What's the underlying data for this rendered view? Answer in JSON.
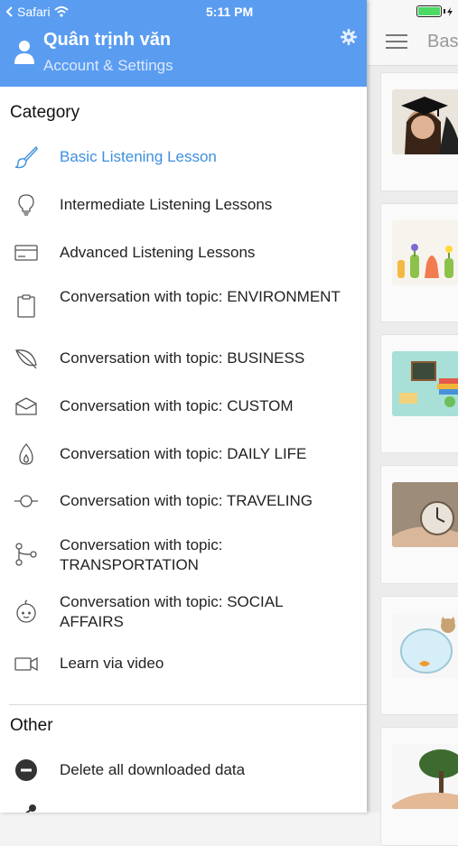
{
  "status": {
    "carrier": "Safari",
    "time": "5:11 PM"
  },
  "content": {
    "title": "Bas"
  },
  "drawer": {
    "user_name": "Quân trịnh văn",
    "subtitle": "Account & Settings",
    "category_title": "Category",
    "items": [
      {
        "label": "Basic Listening Lesson",
        "icon": "paintbrush-icon",
        "active": true
      },
      {
        "label": "Intermediate Listening Lessons",
        "icon": "lightbulb-icon"
      },
      {
        "label": "Advanced Listening Lessons",
        "icon": "card-icon"
      },
      {
        "label": "Conversation with topic: ENVIRONMENT",
        "icon": "clipboard-icon"
      },
      {
        "label": "Conversation with topic: BUSINESS",
        "icon": "leaf-icon"
      },
      {
        "label": "Conversation with topic: CUSTOM",
        "icon": "envelope-open-icon"
      },
      {
        "label": "Conversation with topic: DAILY LIFE",
        "icon": "flame-icon"
      },
      {
        "label": "Conversation with topic: TRAVELING",
        "icon": "commit-icon"
      },
      {
        "label": "Conversation with topic: TRANSPORTATION",
        "icon": "branch-icon"
      },
      {
        "label": "Conversation with topic: SOCIAL AFFAIRS",
        "icon": "baby-icon"
      },
      {
        "label": "Learn via video",
        "icon": "video-camera-icon"
      }
    ],
    "other_title": "Other",
    "other_items": [
      {
        "label": "Delete all downloaded data",
        "icon": "minus-circle-icon"
      }
    ]
  },
  "colors": {
    "header": "#5a9cf0",
    "active": "#3d8fe0"
  }
}
